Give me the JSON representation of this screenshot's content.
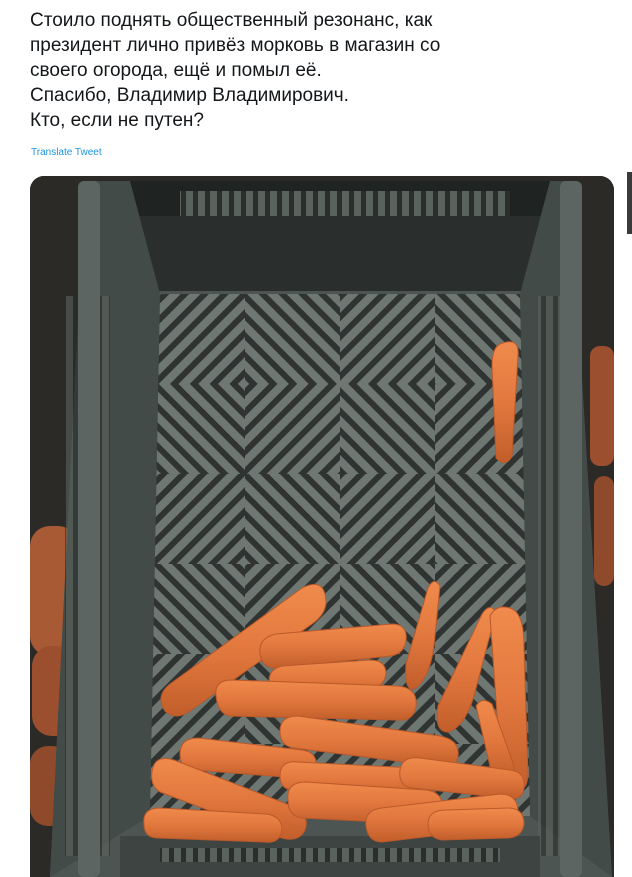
{
  "tweet": {
    "lines": [
      "Стоило поднять общественный резонанс, как",
      "президент лично привёз морковь в магазин со",
      "своего огорода, ещё и помыл её.",
      "Спасибо, Владимир Владимирович.",
      "Кто, если не путен?"
    ],
    "translate_label": "Translate Tweet"
  },
  "photo": {
    "subject": "carrots-in-crate"
  },
  "colors": {
    "text": "#14171a",
    "link": "#1b95e0",
    "crate": "#4d5552",
    "carrot": "#e2783e"
  }
}
